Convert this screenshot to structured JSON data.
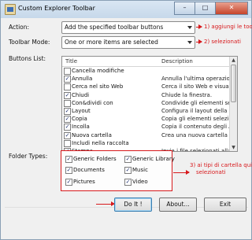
{
  "window": {
    "title": "Custom Explorer Toolbar",
    "controls": {
      "minimize": "–",
      "maximize": "□",
      "close": "✕"
    }
  },
  "form": {
    "action_label": "Action:",
    "action_value": "Add the specified toolbar buttons",
    "mode_label": "Toolbar Mode:",
    "mode_value": "One or more items are selected",
    "buttons_label": "Buttons List:",
    "folder_types_label": "Folder Types:"
  },
  "annotations": {
    "note1": "1) aggiungi le toolbar",
    "note2": "2) selezionati",
    "note3_line1": "3) ai tipi di cartella qui",
    "note3_line2": "selezionati",
    "accent_color": "#d7191c"
  },
  "list": {
    "col_title": "Title",
    "col_desc": "Description",
    "rows": [
      {
        "title": "Cancella modifiche",
        "desc": "",
        "checked": false
      },
      {
        "title": "Annulla",
        "desc": "Annulla l'ultima operazione.",
        "checked": true
      },
      {
        "title": "Cerca nel sito Web",
        "desc": "Cerca il sito Web e visualizza i",
        "checked": false
      },
      {
        "title": "Chiudi",
        "desc": "Chiude la finestra.",
        "checked": true
      },
      {
        "title": "Con&dividi con",
        "desc": "Condivide gli elementi selezi",
        "checked": false
      },
      {
        "title": "Layout",
        "desc": "Configura il layout della cartel",
        "checked": true
      },
      {
        "title": "Copia",
        "desc": "Copia gli elementi selezionati",
        "checked": true
      },
      {
        "title": "Incolla",
        "desc": "Copia il contenuto degli Appu",
        "checked": true
      },
      {
        "title": "Nuova cartella",
        "desc": "Crea una nuova cartella vuota",
        "checked": true
      },
      {
        "title": "Includi nella raccolta",
        "desc": "",
        "checked": false
      },
      {
        "title": "Stampa",
        "desc": "Invia i file selezionati alla sta",
        "checked": true
      }
    ]
  },
  "folder_types": [
    {
      "label": "Generic Folders",
      "checked": true
    },
    {
      "label": "Generic Library",
      "checked": true
    },
    {
      "label": "Documents",
      "checked": true
    },
    {
      "label": "Music",
      "checked": true
    },
    {
      "label": "Pictures",
      "checked": true
    },
    {
      "label": "Video",
      "checked": true
    }
  ],
  "buttons": {
    "do_it": "Do It !",
    "about": "About...",
    "exit": "Exit"
  },
  "icons": {
    "check": "✓",
    "up": "▲",
    "down": "▼"
  }
}
